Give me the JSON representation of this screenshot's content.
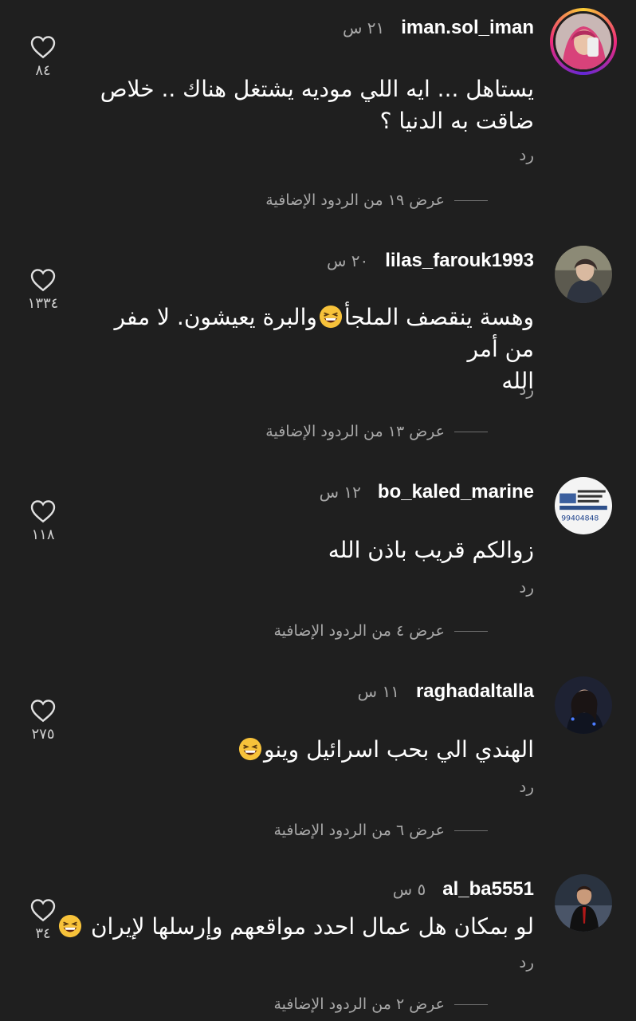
{
  "comments": [
    {
      "username": "iman.sol_iman",
      "time": "٢١ س",
      "lines": [
        "يستاهل ... ايه اللي موديه يشتغل هناك .. خلاص",
        "ضاقت به الدنيا ؟"
      ],
      "reply_label": "رد",
      "more_replies": "عرض ١٩ من الردود الإضافية",
      "likes": "٨٤",
      "avatar_icon": "profile-photo-woman-pink-hijab",
      "has_story_ring": true
    },
    {
      "username": "lilas_farouk1993",
      "time": "٢٠ س",
      "lines": [
        "وهسة ينقصف الملجأ",
        "والبرة يعيشون. لا مفر من أمر",
        "الله"
      ],
      "emoji": "grinning-squinting-face",
      "reply_label": "رد",
      "more_replies": "عرض ١٣ من الردود الإضافية",
      "likes": "١٣٣٤",
      "avatar_icon": "profile-photo-woman-in-car"
    },
    {
      "username": "bo_kaled_marine",
      "time": "١٢ س",
      "lines": [
        "زوالكم قريب باذن الله"
      ],
      "reply_label": "رد",
      "more_replies": "عرض ٤ من الردود الإضافية",
      "likes": "١١٨",
      "avatar_icon": "business-card-logo",
      "avatar_phone": "99404848"
    },
    {
      "username": "raghadaltalla",
      "time": "١١ س",
      "lines": [
        "الهندي الي بحب اسرائيل وينو"
      ],
      "emoji": "grinning-squinting-face",
      "reply_label": "رد",
      "more_replies": "عرض ٦ من الردود الإضافية",
      "likes": "٢٧٥",
      "avatar_icon": "profile-photo-woman-dark"
    },
    {
      "username": "al_ba5551",
      "time": "٥ س",
      "lines": [
        "لو بمكان هل عمال احدد مواقعهم وإرسلها لإيران"
      ],
      "emoji": "grinning-squinting-face",
      "reply_label": "رد",
      "more_replies": "عرض ٢ من الردود الإضافية",
      "likes": "٣٤",
      "avatar_icon": "profile-photo-man-suit"
    }
  ],
  "colors": {
    "background": "#1f1f1f",
    "primary_text": "#ffffff",
    "secondary_text": "#a8a8a8",
    "emoji_yellow": "#f7c23a"
  }
}
